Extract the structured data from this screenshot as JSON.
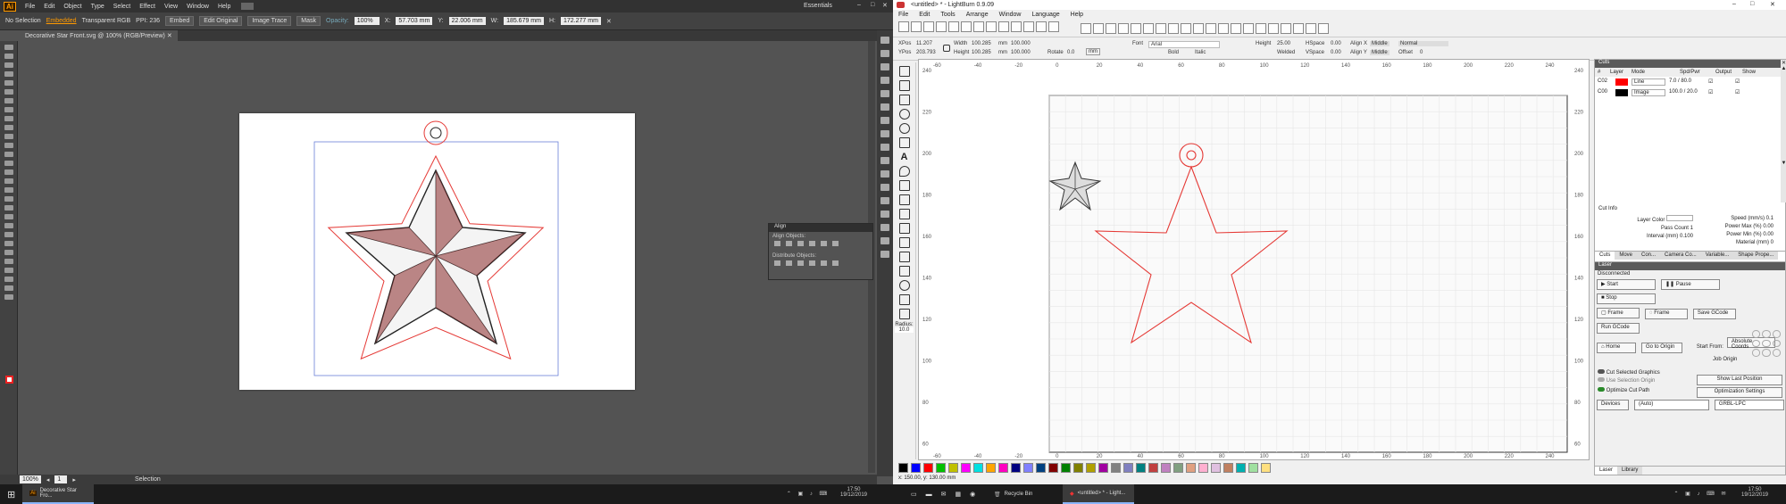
{
  "illustrator": {
    "logo": "Ai",
    "menu": [
      "File",
      "Edit",
      "Object",
      "Type",
      "Select",
      "Effect",
      "View",
      "Window",
      "Help"
    ],
    "workspace": "Essentials",
    "control": {
      "selection": "No Selection",
      "embedded": "Embedded",
      "color_mode": "Transparent RGB",
      "ppi": "PPI: 236",
      "embed_btn": "Embed",
      "edit_original_btn": "Edit Original",
      "image_trace_btn": "Image Trace",
      "mask_btn": "Mask",
      "opacity_label": "Opacity:",
      "opacity": "100%",
      "x": "57.703 mm",
      "y": "22.006 mm",
      "w": "185.679 mm",
      "h": "172.277 mm"
    },
    "doc_tab": "Decorative Star Front.svg @ 100% (RGB/Preview)",
    "align_panel": {
      "title": "Align",
      "align_objects": "Align Objects:",
      "distribute_objects": "Distribute Objects:"
    },
    "status": {
      "zoom": "100%",
      "page": "1",
      "tool": "Selection"
    }
  },
  "lightburn": {
    "title": "<untitled> * - LightBurn 0.9.09",
    "menu": [
      "File",
      "Edit",
      "Tools",
      "Arrange",
      "Window",
      "Language",
      "Help"
    ],
    "props": {
      "xpos_label": "XPos",
      "xpos": "11.207",
      "ypos_label": "YPos",
      "ypos": "203.793",
      "width_label": "Width",
      "width": "100.285",
      "height_label": "Height",
      "height": "100.285",
      "w_pct": "100.000",
      "h_pct": "100.000",
      "unit": "mm",
      "rotate_label": "Rotate",
      "rotate": "0.0",
      "font_label": "Font",
      "font": "Arial",
      "fheight_label": "Height",
      "fheight": "25.00",
      "hspace_label": "HSpace",
      "hspace": "0.00",
      "vspace_label": "VSpace",
      "vspace": "0.00",
      "alignx_label": "Align X",
      "alignx": "Middle",
      "aligny_label": "Align Y",
      "aligny": "Middle",
      "normal": "Normal",
      "offset_label": "Offset",
      "offset": "0",
      "bold": "Bold",
      "italic": "Italic",
      "welded": "Welded",
      "upper_case": "Upper Case",
      "radius_label": "Radius:",
      "radius": "10.0"
    },
    "ruler_x": [
      "-60",
      "-40",
      "-20",
      "0",
      "20",
      "40",
      "60",
      "80",
      "100",
      "120",
      "140",
      "160",
      "180",
      "200",
      "220",
      "240"
    ],
    "ruler_y": [
      "240",
      "220",
      "200",
      "180",
      "160",
      "140",
      "120",
      "100",
      "80",
      "60"
    ],
    "palette": [
      "#000000",
      "#0000ff",
      "#ff0000",
      "#00c000",
      "#c0c000",
      "#ff00ff",
      "#00e0e0",
      "#ffa500",
      "#ff00c0",
      "#000080",
      "#8080ff",
      "#004080",
      "#800000",
      "#008000",
      "#808000",
      "#b0a000",
      "#a000a0",
      "#808080",
      "#8080c0",
      "#008080",
      "#c04040",
      "#c080c0",
      "#80a080",
      "#e0a080",
      "#ffb0d0",
      "#e0c0e0",
      "#c08060",
      "#00b0b0",
      "#a0e0a0",
      "#ffe080"
    ],
    "status": "x: 150.00, y: 130.00 mm",
    "cuts": {
      "title": "Cuts",
      "headers": [
        "#",
        "Layer",
        "Mode",
        "Spd/Pwr",
        "Output",
        "Show"
      ],
      "rows": [
        {
          "num": "C02",
          "color": "#ff0000",
          "mode": "Line",
          "sp": "7.0 / 80.0"
        },
        {
          "num": "C00",
          "color": "#000000",
          "mode": "Image",
          "sp": "100.0 / 20.0"
        }
      ],
      "cut_info": "Cut Info",
      "info": [
        {
          "label": "Layer Color",
          "value": ""
        },
        {
          "label": "Pass Count",
          "value": "1"
        },
        {
          "label": "Interval (mm)",
          "value": "0.100"
        }
      ],
      "info2": [
        {
          "label": "Speed (mm/s)",
          "value": "0.1"
        },
        {
          "label": "Power Max (%)",
          "value": "0.00"
        },
        {
          "label": "Power Min (%)",
          "value": "0.00"
        },
        {
          "label": "Material (mm)",
          "value": "0"
        }
      ],
      "tabs": [
        "Cuts",
        "Move",
        "Con...",
        "Camera Co...",
        "Variable...",
        "Shape Prope..."
      ]
    },
    "laser": {
      "title": "Laser",
      "state": "Disconnected",
      "start": "Start",
      "pause": "Pause",
      "stop": "Stop",
      "frame1": "Frame",
      "frame2": "Frame",
      "save_gcode": "Save GCode",
      "run_gcode": "Run GCode",
      "home": "Home",
      "go_origin": "Go to Origin",
      "start_from_label": "Start From:",
      "start_from": "Absolute Coords",
      "job_origin": "Job Origin",
      "cut_selected": "Cut Selected Graphics",
      "use_selection_origin": "Use Selection Origin",
      "optimize": "Optimize Cut Path",
      "show_last": "Show Last Position",
      "opt_settings": "Optimization Settings",
      "devices": "Devices",
      "auto": "(Auto)",
      "grbl": "GRBL-LPC",
      "tabs": [
        "Laser",
        "Library"
      ]
    }
  },
  "taskbar": {
    "items": [
      {
        "label": "Decorative Star Fro..."
      },
      {
        "label": "Recycle Bin"
      },
      {
        "label": "<untitled> * - Light..."
      }
    ],
    "time_left": "17:50",
    "date_left": "19/12/2019",
    "time_right": "17:50",
    "date_right": "19/12/2019"
  }
}
